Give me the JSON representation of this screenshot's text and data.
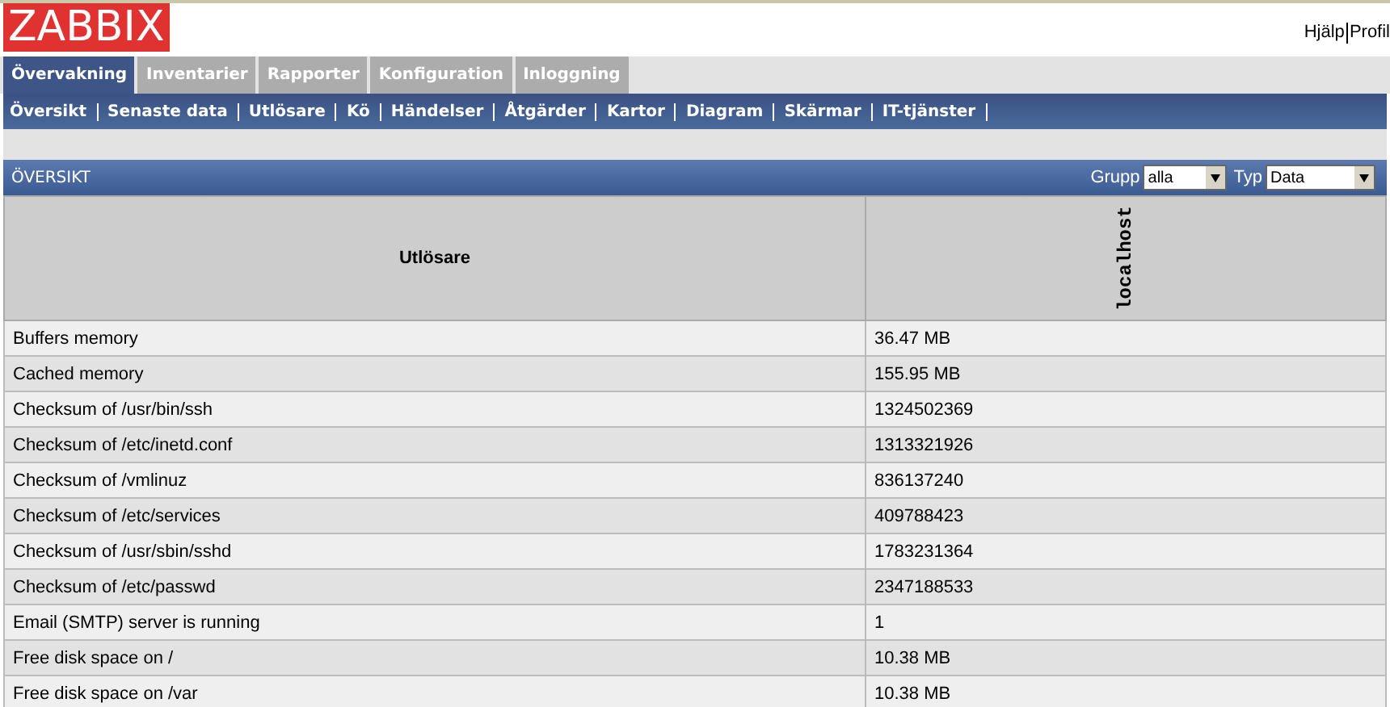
{
  "logo": "ZABBIX",
  "header_links": [
    "Hjälp",
    "Profil"
  ],
  "main_tabs": [
    {
      "label": "Övervakning",
      "selected": true
    },
    {
      "label": "Inventarier",
      "selected": false
    },
    {
      "label": "Rapporter",
      "selected": false
    },
    {
      "label": "Konfiguration",
      "selected": false
    },
    {
      "label": "Inloggning",
      "selected": false
    }
  ],
  "sub_nav": [
    "Översikt",
    "Senaste data",
    "Utlösare",
    "Kö",
    "Händelser",
    "Åtgärder",
    "Kartor",
    "Diagram",
    "Skärmar",
    "IT-tjänster"
  ],
  "panel": {
    "title": "ÖVERSIKT",
    "filters": [
      {
        "label": "Grupp",
        "value": "alla"
      },
      {
        "label": "Typ",
        "value": "Data"
      }
    ]
  },
  "table": {
    "columns": [
      "Utlösare",
      "localhost"
    ],
    "rows": [
      [
        "Buffers memory",
        "36.47 MB"
      ],
      [
        "Cached memory",
        "155.95 MB"
      ],
      [
        "Checksum of /usr/bin/ssh",
        "1324502369"
      ],
      [
        "Checksum of /etc/inetd.conf",
        "1313321926"
      ],
      [
        "Checksum of /vmlinuz",
        "836137240"
      ],
      [
        "Checksum of /etc/services",
        "409788423"
      ],
      [
        "Checksum of /usr/sbin/sshd",
        "1783231364"
      ],
      [
        "Checksum of /etc/passwd",
        "2347188533"
      ],
      [
        "Email (SMTP) server is running",
        "1"
      ],
      [
        "Free disk space on /",
        "10.38 MB"
      ],
      [
        "Free disk space on /var",
        "10.38 MB"
      ]
    ]
  }
}
